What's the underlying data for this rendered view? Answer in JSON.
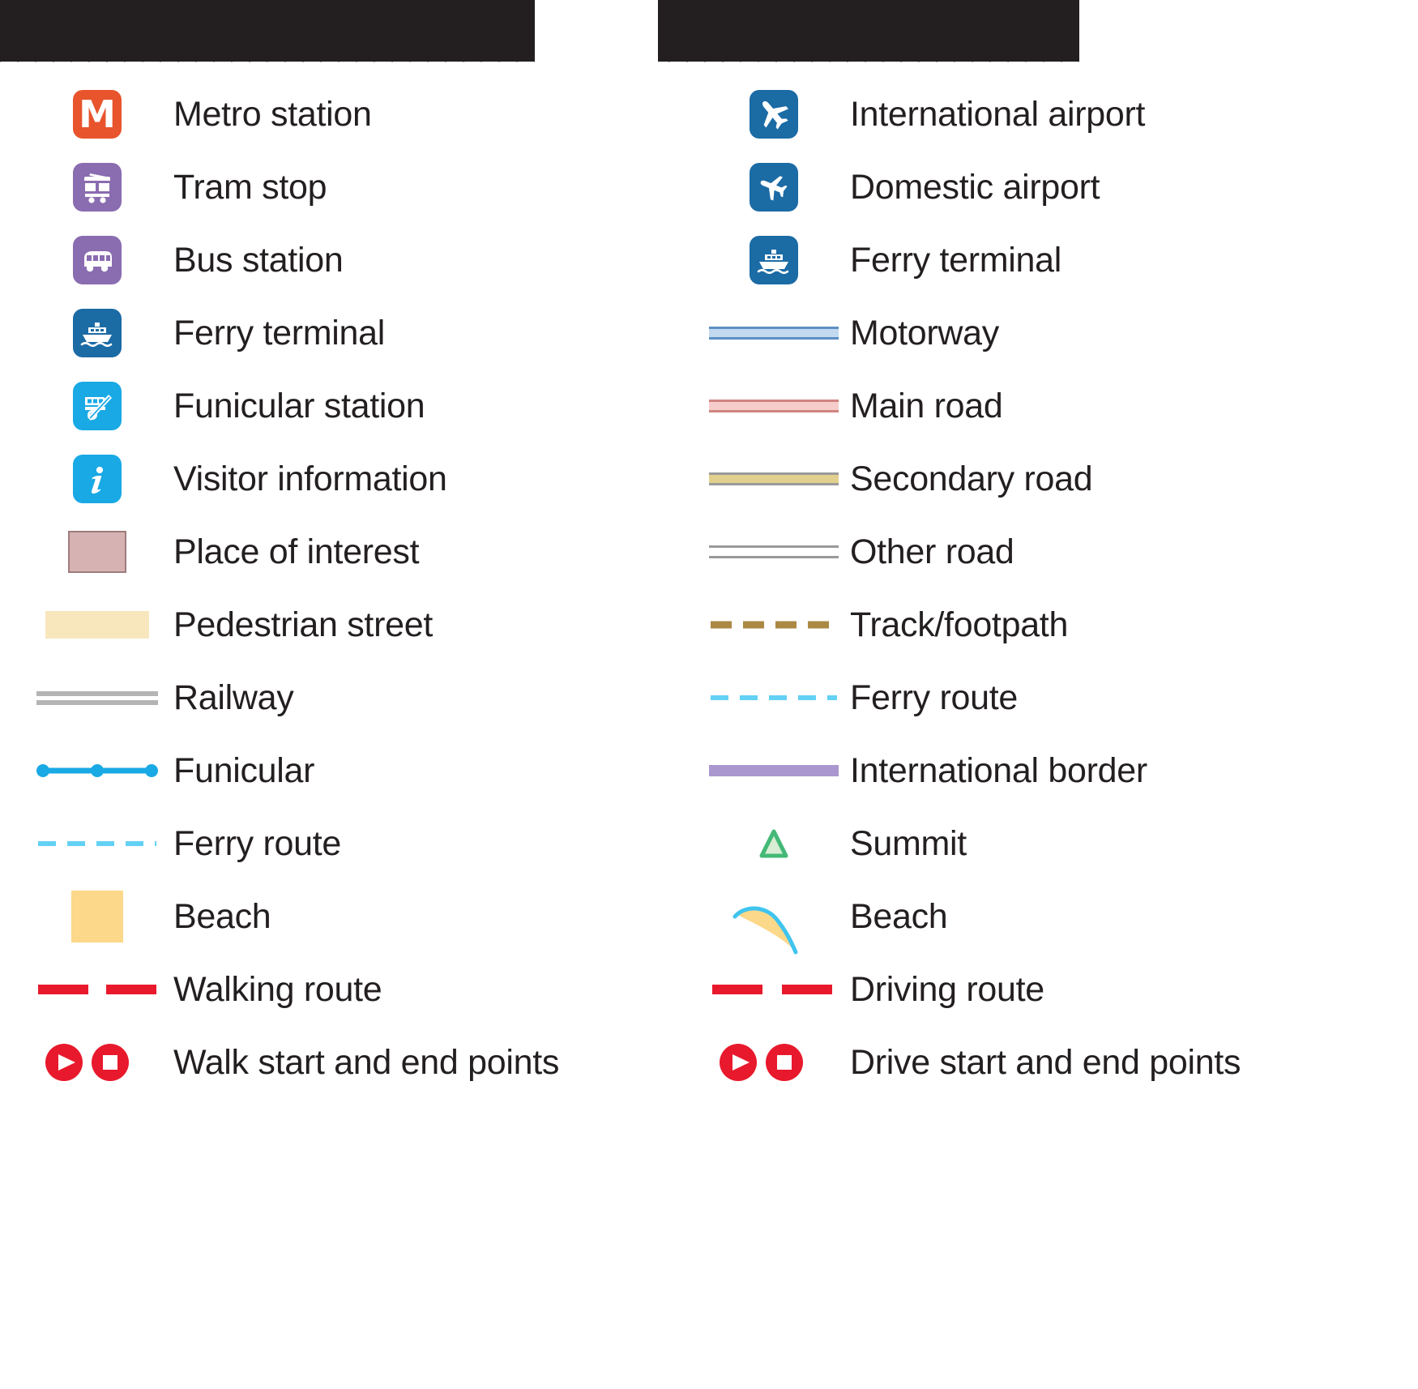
{
  "titles": {
    "left": "",
    "right": ""
  },
  "colors": {
    "metro_orange": "#e8542c",
    "tram_purple": "#8a6cb0",
    "bus_purple": "#8a6cb0",
    "ferry_blue": "#1b6ba5",
    "funicular_cyan": "#19a9e5",
    "info_cyan": "#19a9e5",
    "airport_blue": "#1b6ba5",
    "poi_fill": "#d7b2b2",
    "poi_stroke": "#9e7d7d",
    "pedestrian": "#f8e6bd",
    "railway_gray": "#b4b4b4",
    "ferry_route": "#63d1f4",
    "beach_yellow": "#fcd88a",
    "route_red": "#e8192c",
    "motorway_fill": "#c2d9f0",
    "motorway_casing": "#5d8fc4",
    "mainroad_fill": "#f6cdcb",
    "mainroad_casing": "#d0847f",
    "secondary_fill": "#e2d08e",
    "secondary_casing": "#9a9a9a",
    "otherroad_fill": "#ffffff",
    "otherroad_casing": "#9a9a9a",
    "track_brown": "#ab8843",
    "border_purple": "#ab97cf",
    "summit_green": "#44b977",
    "summit_fill": "#d8edd3",
    "coast_blue": "#3fc4f0",
    "text": "#231f20"
  },
  "left_column": {
    "items": [
      {
        "icon": "metro-icon",
        "label": "Metro station"
      },
      {
        "icon": "tram-icon",
        "label": "Tram stop"
      },
      {
        "icon": "bus-icon",
        "label": "Bus station"
      },
      {
        "icon": "ferry-terminal-icon",
        "label": "Ferry terminal"
      },
      {
        "icon": "funicular-station-icon",
        "label": "Funicular station"
      },
      {
        "icon": "visitor-information-icon",
        "label": "Visitor information"
      },
      {
        "icon": "place-of-interest-swatch",
        "label": "Place of interest"
      },
      {
        "icon": "pedestrian-street-swatch",
        "label": "Pedestrian street"
      },
      {
        "icon": "railway-line-symbol",
        "label": "Railway"
      },
      {
        "icon": "funicular-line-symbol",
        "label": "Funicular"
      },
      {
        "icon": "ferry-route-line-symbol",
        "label": "Ferry route"
      },
      {
        "icon": "beach-swatch",
        "label": "Beach"
      },
      {
        "icon": "walking-route-line-symbol",
        "label": "Walking route"
      },
      {
        "icon": "walk-start-end-icon",
        "label": "Walk start and end points"
      }
    ]
  },
  "right_column": {
    "items": [
      {
        "icon": "international-airport-icon",
        "label": "International airport"
      },
      {
        "icon": "domestic-airport-icon",
        "label": "Domestic airport"
      },
      {
        "icon": "ferry-terminal-icon",
        "label": "Ferry terminal"
      },
      {
        "icon": "motorway-line-symbol",
        "label": "Motorway"
      },
      {
        "icon": "main-road-line-symbol",
        "label": "Main road"
      },
      {
        "icon": "secondary-road-line-symbol",
        "label": "Secondary road"
      },
      {
        "icon": "other-road-line-symbol",
        "label": "Other road"
      },
      {
        "icon": "track-footpath-line-symbol",
        "label": "Track/footpath"
      },
      {
        "icon": "ferry-route-line-symbol",
        "label": "Ferry route"
      },
      {
        "icon": "international-border-symbol",
        "label": "International border"
      },
      {
        "icon": "summit-icon",
        "label": "Summit"
      },
      {
        "icon": "beach-coastline-icon",
        "label": "Beach"
      },
      {
        "icon": "driving-route-line-symbol",
        "label": "Driving route"
      },
      {
        "icon": "drive-start-end-icon",
        "label": "Drive start and end points"
      }
    ]
  }
}
